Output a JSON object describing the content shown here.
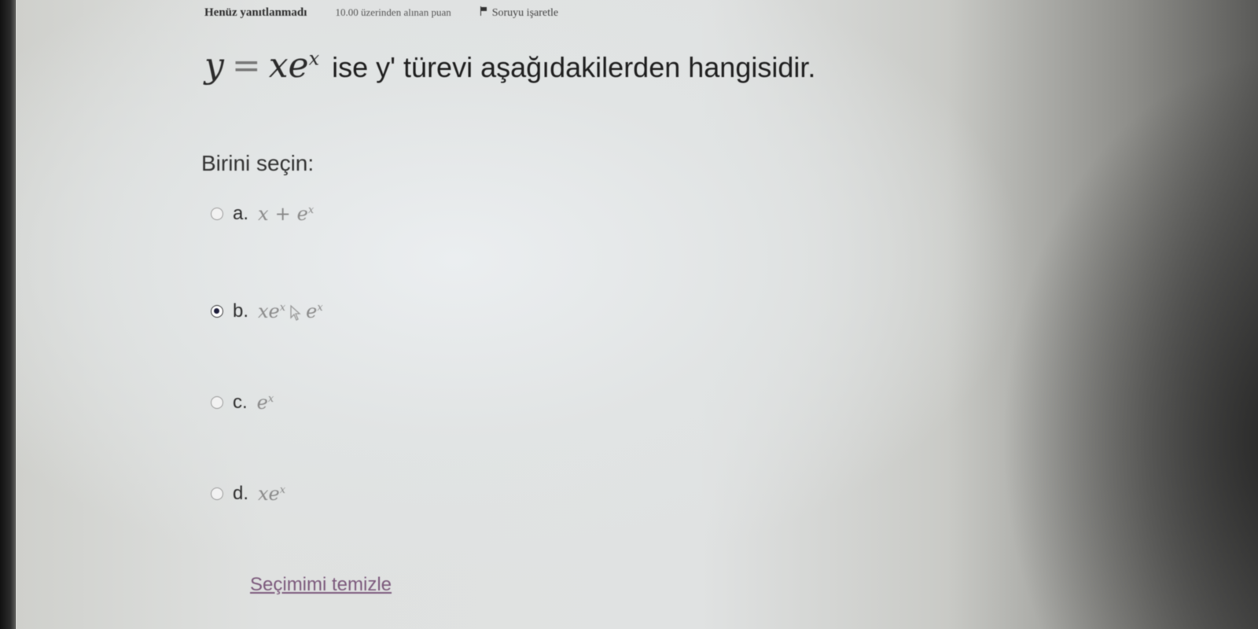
{
  "info": {
    "status": "Henüz yanıtlanmadı",
    "points": "10.00 üzerinden alınan puan",
    "flag_label": "Soruyu işaretle"
  },
  "question": {
    "lhs": "y",
    "equals": "=",
    "rhs_base": "xe",
    "rhs_exp": "x",
    "text": "ise y' türevi aşağıdakilerden hangisidir."
  },
  "prompt": "Birini seçin:",
  "options": [
    {
      "letter": "a.",
      "part1": "x",
      "op": "+",
      "part2": "e",
      "part2_exp": "x",
      "selected": false
    },
    {
      "letter": "b.",
      "part1": "xe",
      "part1_exp": "x",
      "op": "+",
      "part2": "e",
      "part2_exp": "x",
      "selected": true
    },
    {
      "letter": "c.",
      "part1": "e",
      "part1_exp": "x",
      "selected": false
    },
    {
      "letter": "d.",
      "part1": "xe",
      "part1_exp": "x",
      "selected": false
    }
  ],
  "clear_label": "Seçimimi temizle",
  "icons": {
    "flag": "flag-icon",
    "cursor": "mouse-cursor-icon",
    "radio": "radio-button"
  }
}
